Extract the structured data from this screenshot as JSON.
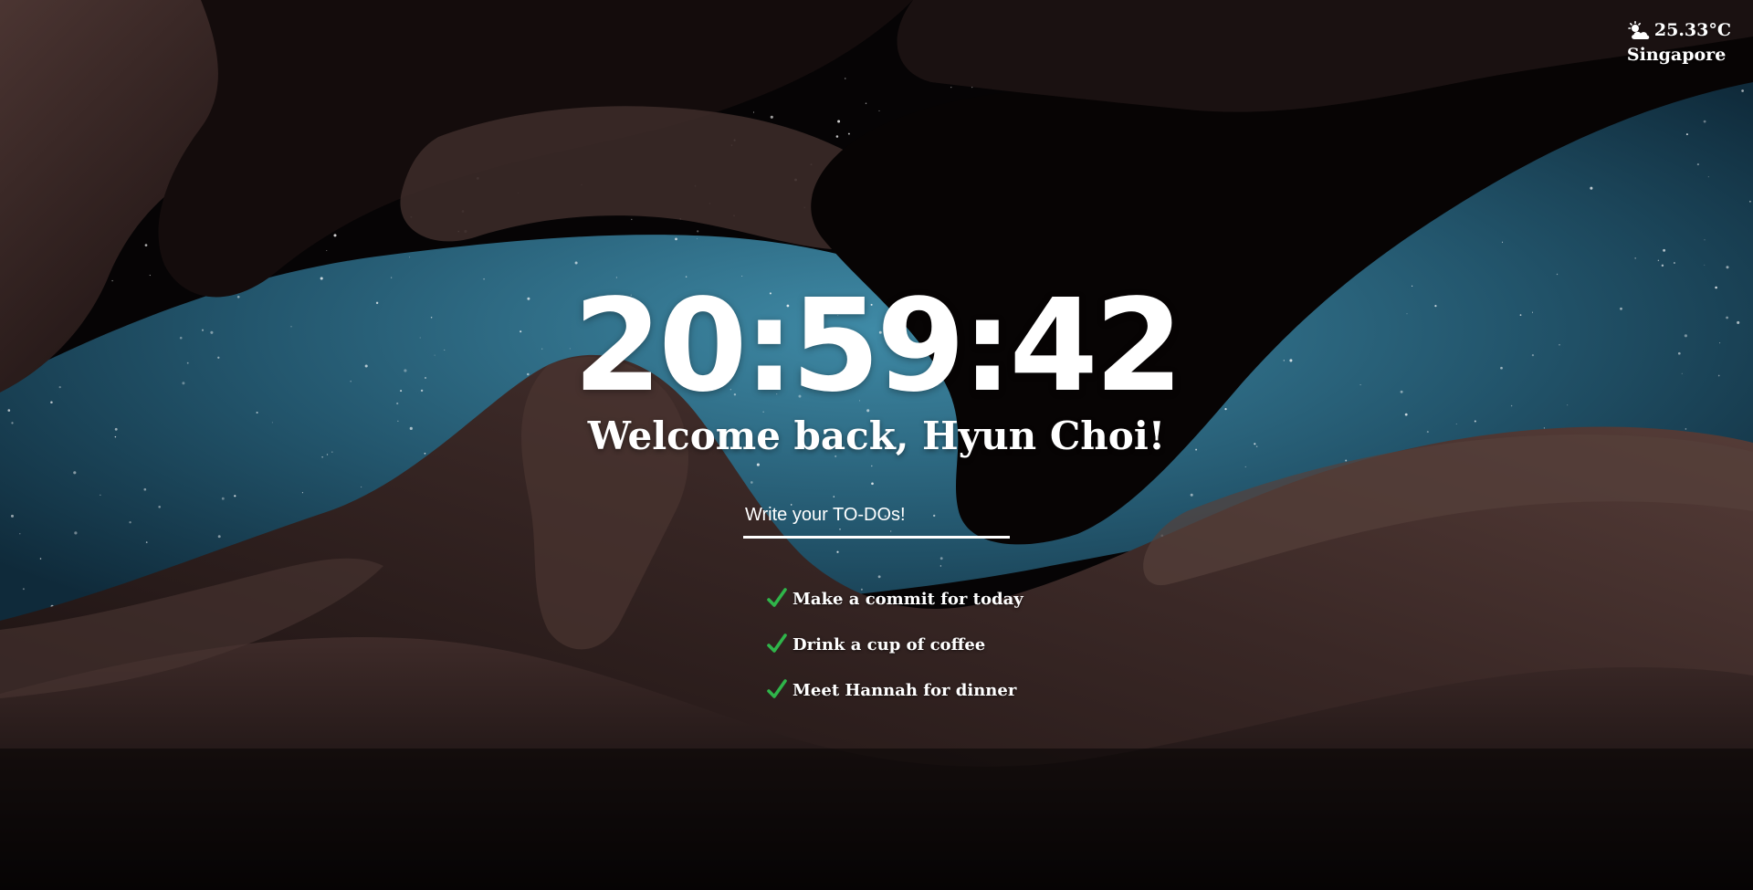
{
  "weather": {
    "icon": "partly-cloudy-icon",
    "temperature": "25.33°C",
    "city": "Singapore"
  },
  "clock": {
    "time": "20:59:42"
  },
  "greeting": {
    "text": "Welcome back, Hyun Choi!"
  },
  "todo_form": {
    "placeholder": "Write your TO-DOs!",
    "value": ""
  },
  "todos": {
    "items": [
      {
        "label": "Make a commit for today",
        "icon": "check-icon"
      },
      {
        "label": "Drink a cup of coffee",
        "icon": "check-icon"
      },
      {
        "label": "Meet Hannah for dinner",
        "icon": "check-icon"
      }
    ]
  },
  "colors": {
    "text": "#ffffff",
    "check": "#2fb54a",
    "sky": "#2f6f8a",
    "rock": "#3a2a27"
  }
}
